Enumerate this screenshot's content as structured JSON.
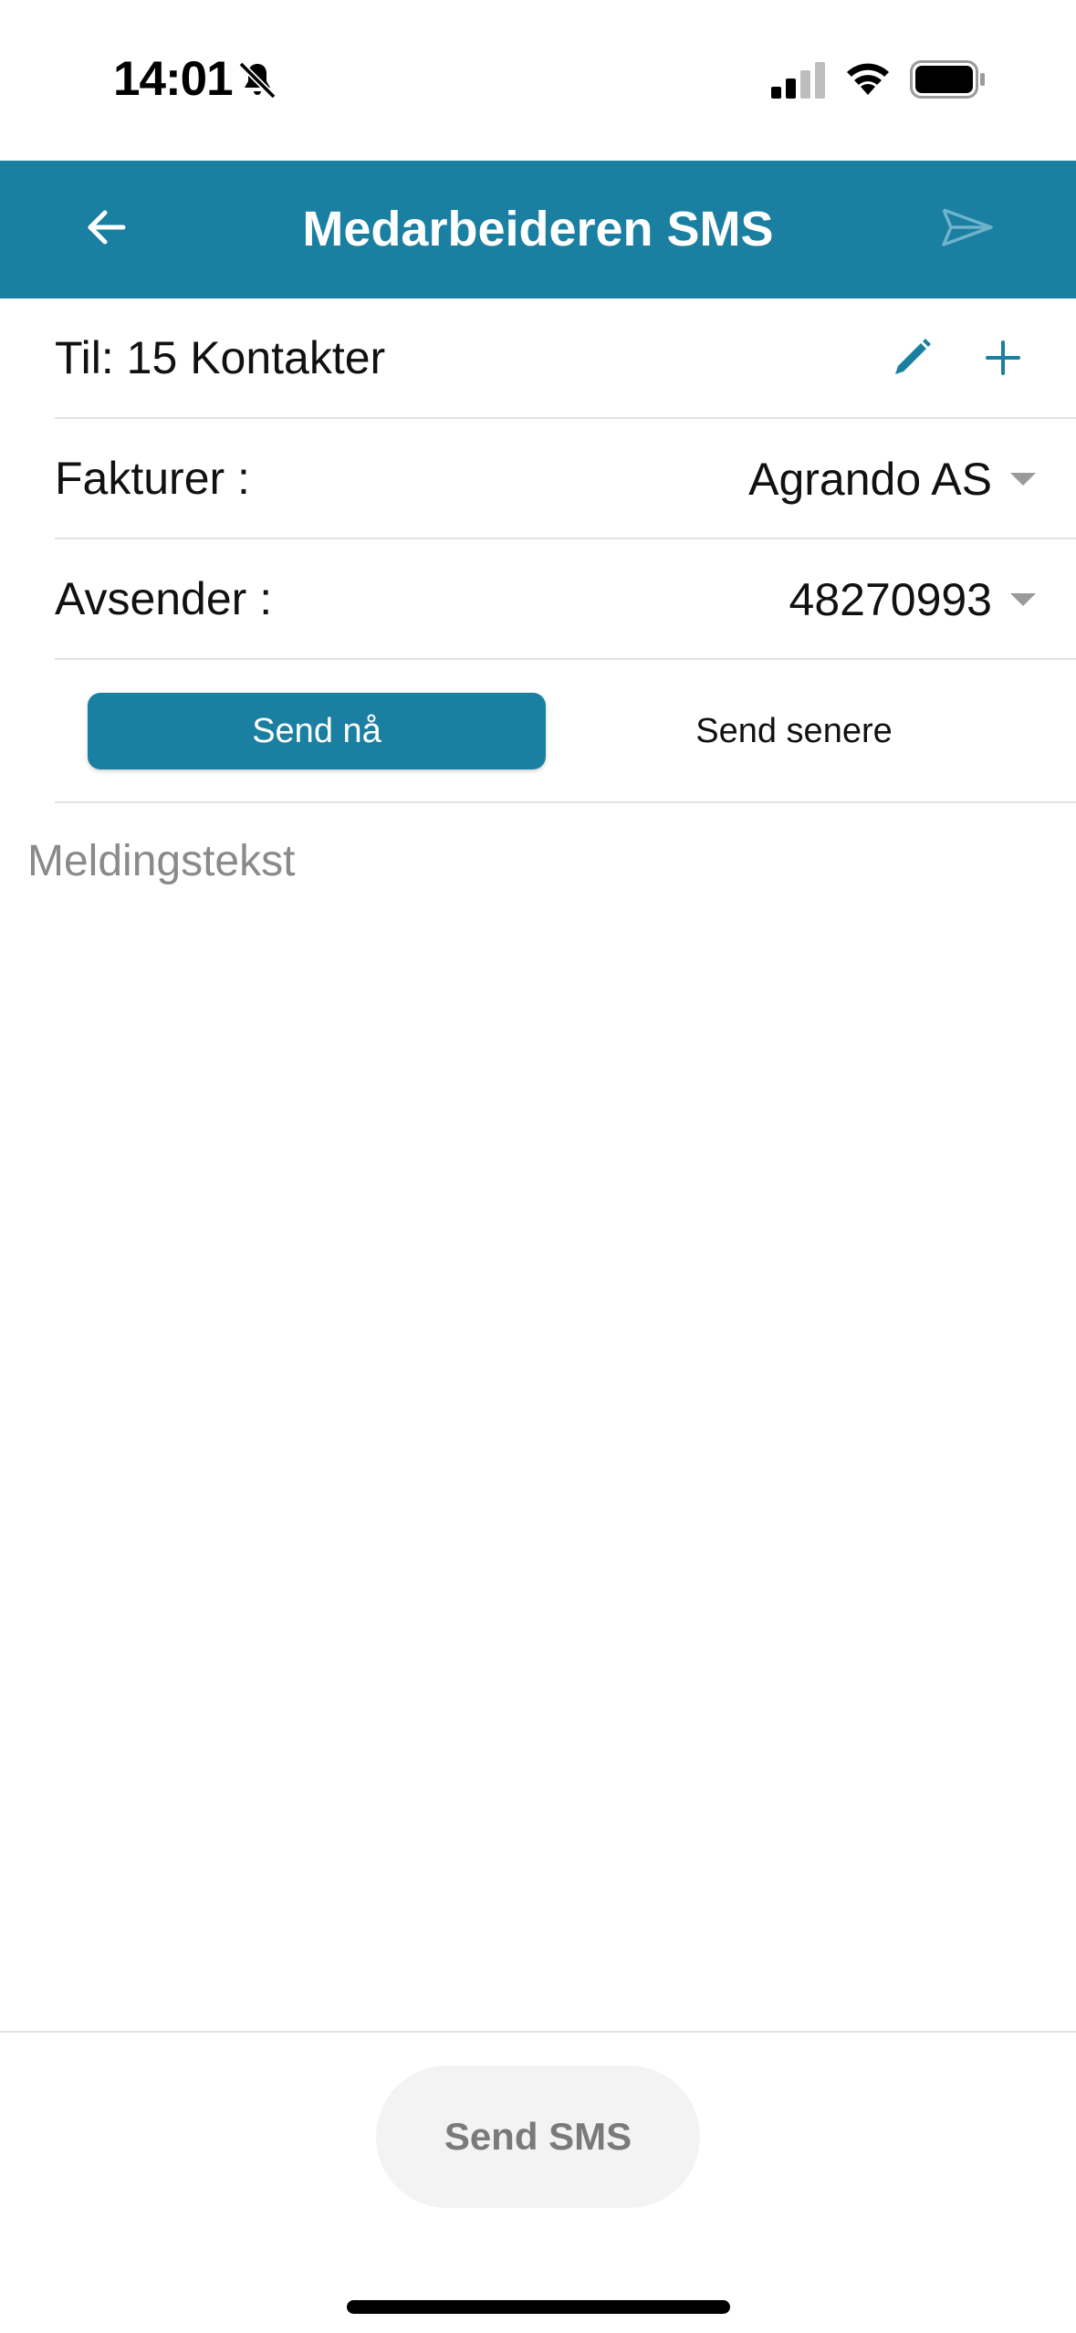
{
  "status_bar": {
    "time": "14:01",
    "icons": [
      "bell-off-icon",
      "signal-icon",
      "wifi-icon",
      "battery-icon"
    ]
  },
  "header": {
    "title": "Medarbeideren SMS",
    "background_color": "#1a7fa1",
    "back_icon": "arrow-left-icon",
    "send_icon": "paper-plane-icon"
  },
  "recipients": {
    "label": "Til: 15 Kontakter",
    "edit_icon": "pencil-icon",
    "add_icon": "plus-icon"
  },
  "invoice": {
    "label": "Fakturer :",
    "value": "Agrando AS"
  },
  "sender": {
    "label": "Avsender :",
    "value": "48270993"
  },
  "schedule": {
    "send_now_label": "Send nå",
    "send_later_label": "Send senere",
    "selected": "Send nå"
  },
  "message": {
    "placeholder": "Meldingstekst",
    "value": ""
  },
  "footer": {
    "send_sms_label": "Send SMS"
  }
}
